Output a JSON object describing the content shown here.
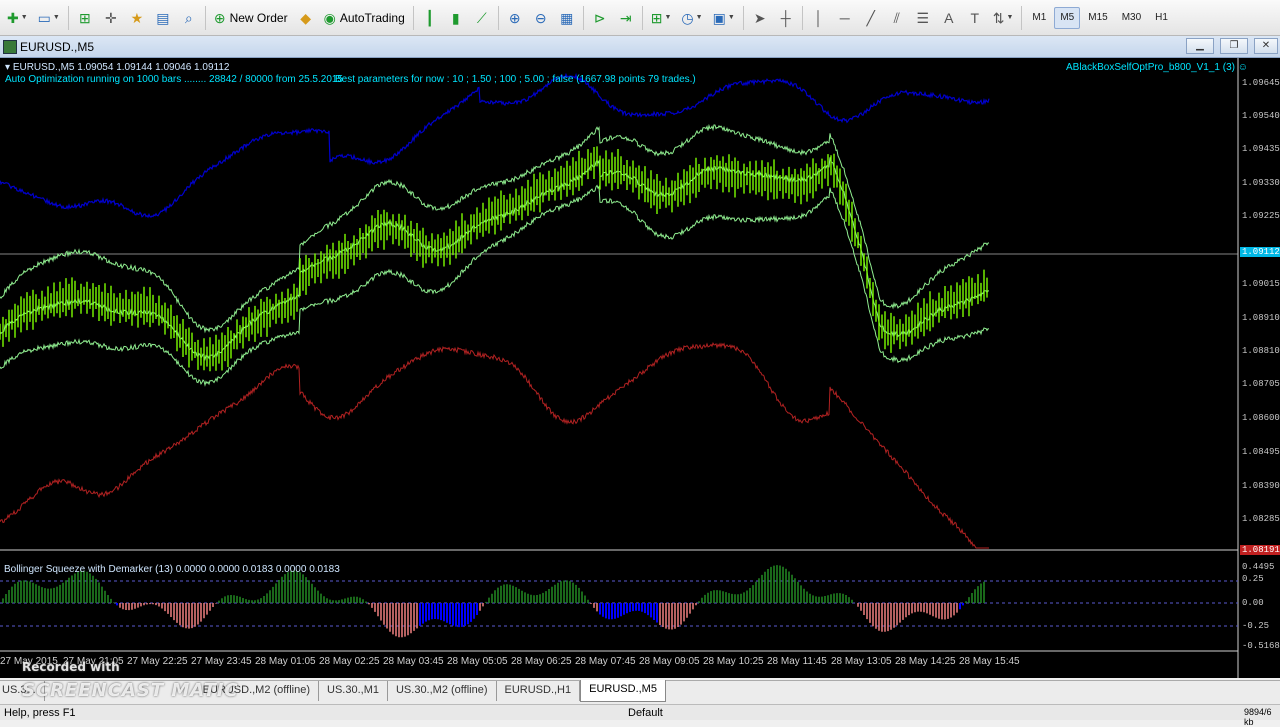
{
  "toolbar": {
    "new_order": "New Order",
    "autotrading": "AutoTrading",
    "timeframes": [
      "M1",
      "M5",
      "M15",
      "M30",
      "H1"
    ],
    "active_timeframe": "M5"
  },
  "window": {
    "title": "EURUSD.,M5"
  },
  "chart": {
    "info_line": "EURUSD.,M5  1.09054 1.09144 1.09046 1.09112",
    "ea_status": "Auto Optimization running on 1000 bars ........ 28842 / 80000 from 25.5.2015",
    "best_params": "Best parameters for now : 10 ; 1.50 ; 100 ; 5.00 ; false (1667.98 points 79 trades.)",
    "ea_name": "ABlackBoxSelfOptPro_b800_V1_1 (3)",
    "current_price": "1.09112",
    "lower_price_marker": "1.08191",
    "price_scale": [
      "1.09645",
      "1.09540",
      "1.09435",
      "1.09330",
      "1.09225",
      "1.09015",
      "1.08910",
      "1.08810",
      "1.08705",
      "1.08600",
      "1.08495",
      "1.08390",
      "1.08285"
    ],
    "indicator_title": "Bollinger Squeeze with Demarker (13) 0.0000 0.0000 0.0183 0.0000 0.0183",
    "indicator_scale": [
      "0.4495",
      "0.25",
      "0.00",
      "-0.25",
      "-0.5168"
    ],
    "time_labels": [
      "27 May 2015",
      "27 May 21:05",
      "27 May 22:25",
      "27 May 23:45",
      "28 May 01:05",
      "28 May 02:25",
      "28 May 03:45",
      "28 May 05:05",
      "28 May 06:25",
      "28 May 07:45",
      "28 May 09:05",
      "28 May 10:25",
      "28 May 11:45",
      "28 May 13:05",
      "28 May 14:25",
      "28 May 15:45"
    ],
    "colors": {
      "bars": "#7cfc00",
      "bands": "#90ee90",
      "upper_line": "#0000cd",
      "lower_line": "#b22222",
      "hist_pos": "#228b22",
      "hist_neg": "#f08080",
      "hist_blue": "#0000ff"
    }
  },
  "tabs": [
    "US.3...",
    "EURUSD.,M2 (offline)",
    "US.30.,M1",
    "US.30.,M2 (offline)",
    "EURUSD.,H1",
    "EURUSD.,M5"
  ],
  "active_tab": "EURUSD.,M5",
  "status": {
    "help": "Help, press F1",
    "profile": "Default",
    "traffic": "9894/6 kb"
  },
  "watermark": {
    "line1": "Recorded with",
    "line2": "SCREENCAST MATIC"
  }
}
